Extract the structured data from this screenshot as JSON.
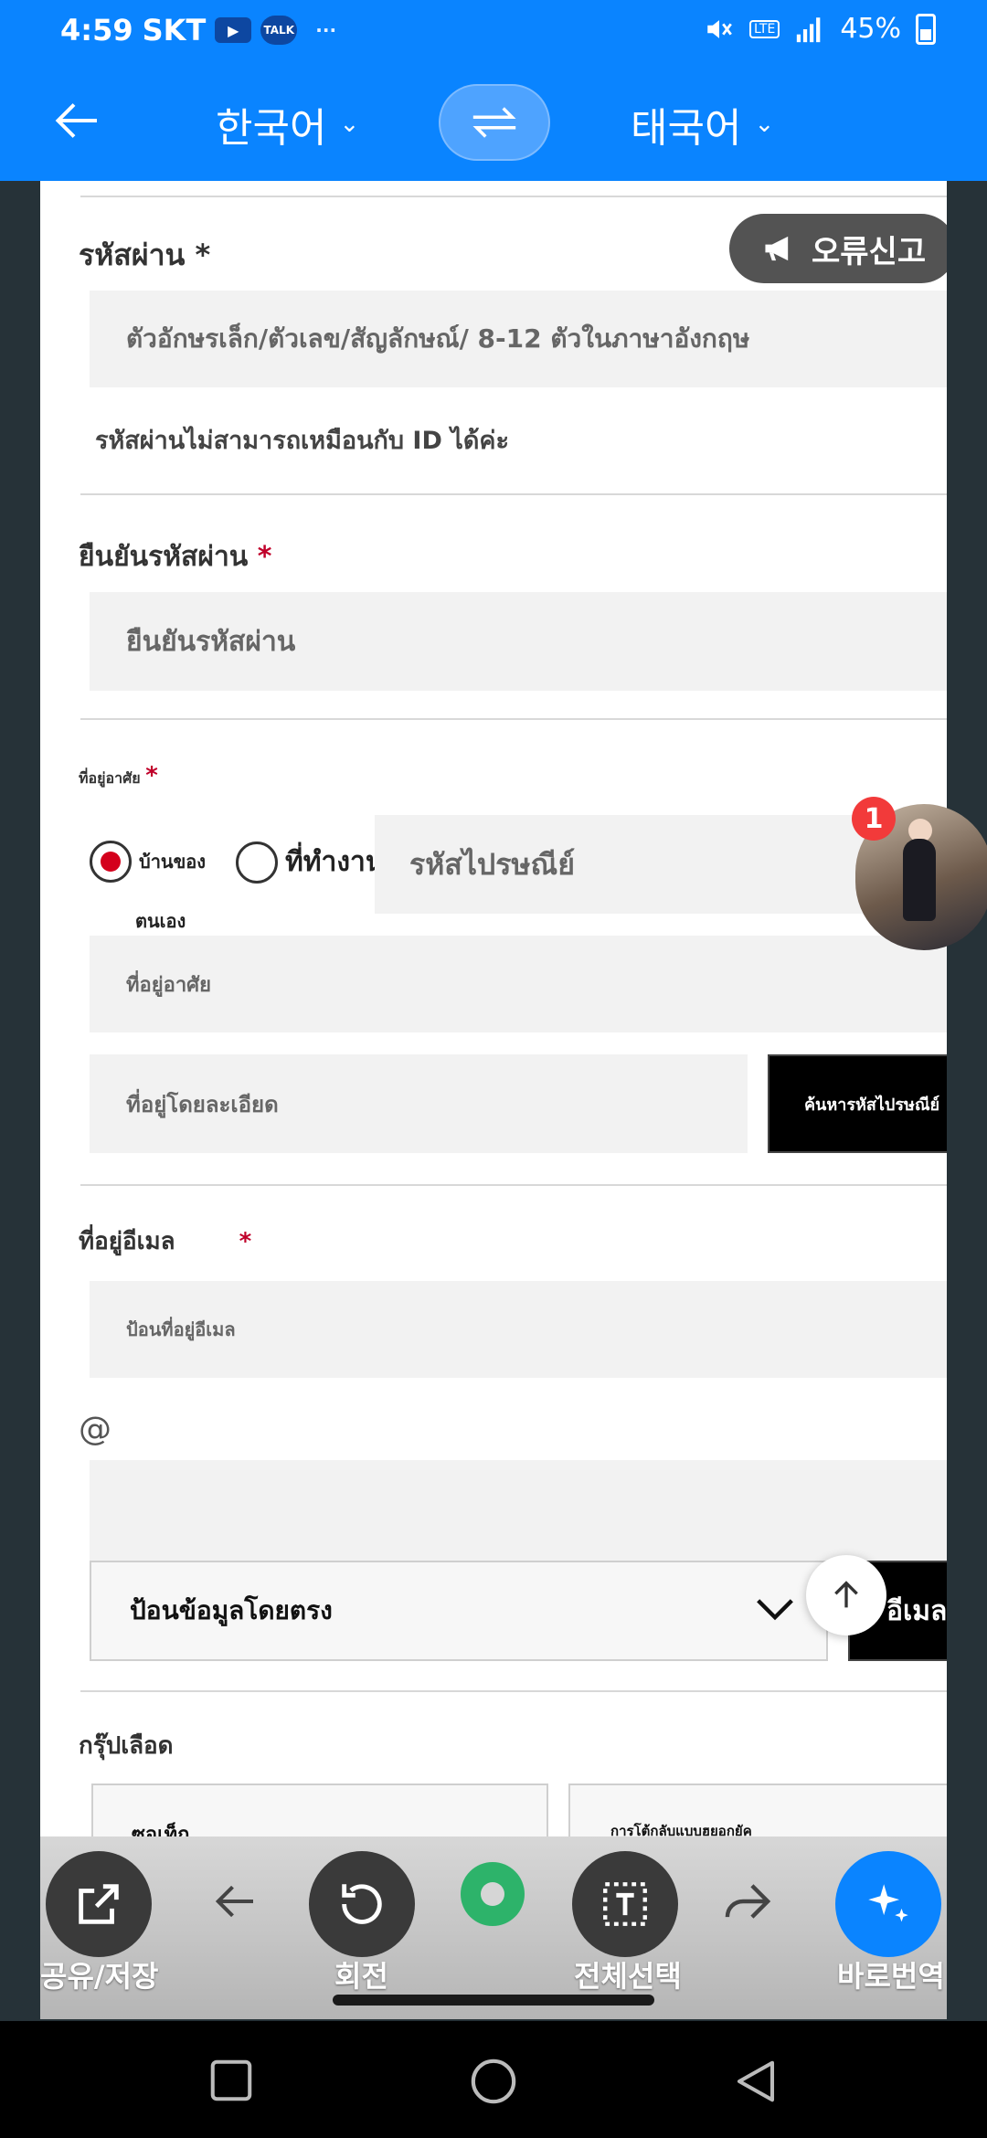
{
  "status": {
    "time": "4:59",
    "carrier": "SKT",
    "yt": "▶",
    "talk": "TALK",
    "dots": "···",
    "lte": "LTE",
    "battery": "45%"
  },
  "header": {
    "source_lang": "한국어",
    "target_lang": "태국어"
  },
  "report_button": "오류신고",
  "form": {
    "password_label": "รหัสผ่าน",
    "required_mark": "*",
    "password_placeholder": "ตัวอักษรเล็ก/ตัวเลข/สัญลักษณ์/ 8-12 ตัวในภาษาอังกฤษ",
    "password_note": "รหัสผ่านไม่สามารถเหมือนกับ ID ได้ค่ะ",
    "confirm_label": "ยืนยันรหัสผ่าน",
    "confirm_placeholder": "ยืนยันรหัสผ่าน",
    "address_label": "ที่อยู่อาศัย",
    "radio_home_line1": "บ้านของ",
    "radio_home_line2": "ตนเอง",
    "radio_work": "ที่ทำงาน",
    "postal_placeholder": "รหัสไปรษณีย์",
    "address_placeholder": "ที่อยู่อาศัย",
    "detail_placeholder": "ที่อยู่โดยละเอียด",
    "postal_search_button": "ค้นหารหัสไปรษณีย์",
    "email_label": "ที่อยู่อีเมล",
    "email_placeholder": "ป้อนที่อยู่อีเมล",
    "at": "@",
    "direct_input": "ป้อนข้อมูลโดยตรง",
    "email_button": "อีเมล",
    "blood_label": "กรุ๊ปเลือด",
    "blood_select": "ซอเท็ก",
    "blood_select2": "การโต้กลับแบบฮยอกยัค"
  },
  "avatar_badge": "1",
  "toolbar": {
    "share": "공유/저장",
    "rotate": "회전",
    "select_all": "전체선택",
    "instant": "바로번역"
  },
  "colors": {
    "accent": "#0a84ff",
    "required": "#c0002a",
    "badge": "#f23a3a"
  }
}
